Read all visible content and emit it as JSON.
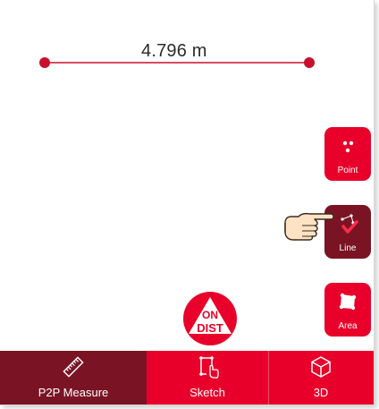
{
  "measurement": {
    "value": "4.796 m"
  },
  "side_buttons": {
    "point_label": "Point",
    "line_label": "Line",
    "area_label": "Area"
  },
  "ondist": {
    "on_label": "ON",
    "dist_label": "DIST"
  },
  "tabbar": {
    "tabs": [
      {
        "label": "P2P Measure",
        "icon": "ruler-icon",
        "selected": true
      },
      {
        "label": "Sketch",
        "icon": "sketch-icon",
        "selected": false
      },
      {
        "label": "3D",
        "icon": "cube-icon",
        "selected": false
      }
    ]
  },
  "colors": {
    "primary_red": "#e8002a",
    "selected_dark_red": "#7a1424",
    "line_red": "#c8102e"
  }
}
